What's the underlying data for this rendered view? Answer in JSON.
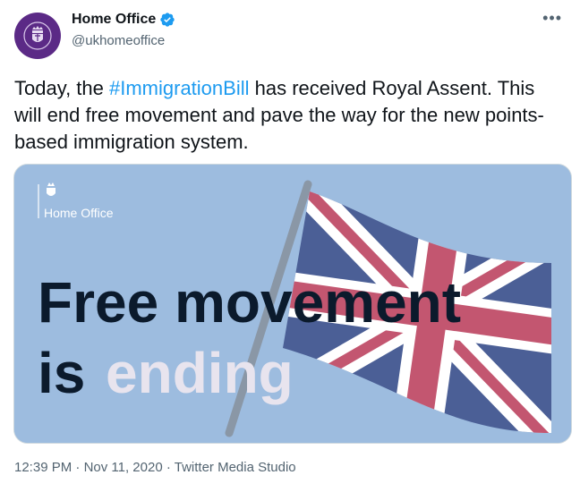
{
  "account": {
    "display_name": "Home Office",
    "handle": "@ukhomeoffice",
    "verified": true,
    "avatar_color": "#5b2a86"
  },
  "tweet": {
    "text_before": "Today, the ",
    "hashtag": "#ImmigrationBill",
    "text_after": " has received Royal Assent. This will end free movement and pave the way for the new points-based immigration system.",
    "hashtag_color": "#1d9bf0"
  },
  "media": {
    "logo_text": "Home Office",
    "headline_line1": "Free movement",
    "headline_line2a": "is",
    "headline_line2b": "ending",
    "background_color": "#9dbcdf",
    "flag_colors": {
      "blue": "#4b5f96",
      "red": "#c35670",
      "white": "#ffffff"
    }
  },
  "meta": {
    "time": "12:39 PM",
    "date": "Nov 11, 2020",
    "source": "Twitter Media Studio",
    "separator": " · "
  },
  "icons": {
    "more": "more-icon",
    "verified": "verified-badge-icon"
  }
}
